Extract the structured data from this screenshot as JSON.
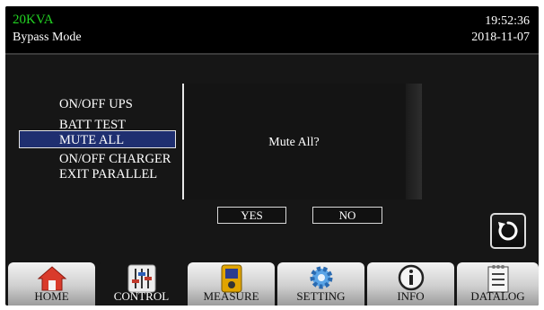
{
  "header": {
    "rating": "20KVA",
    "mode": "Bypass Mode",
    "time": "19:52:36",
    "date": "2018-11-07"
  },
  "menu": {
    "items": [
      "ON/OFF UPS",
      "BATT TEST",
      "MUTE ALL",
      "ON/OFF CHARGER",
      "EXIT PARALLEL"
    ],
    "selected": "MUTE ALL"
  },
  "dialog": {
    "message": "Mute All?",
    "yes_label": "YES",
    "no_label": "NO"
  },
  "back_button": {
    "icon": "refresh-back-icon"
  },
  "navbar": {
    "tabs": [
      {
        "label": "HOME",
        "icon": "home-icon"
      },
      {
        "label": "CONTROL",
        "icon": "sliders-icon"
      },
      {
        "label": "MEASURE",
        "icon": "meter-icon"
      },
      {
        "label": "SETTING",
        "icon": "gear-icon"
      },
      {
        "label": "INFO",
        "icon": "info-icon"
      },
      {
        "label": "DATALOG",
        "icon": "log-icon"
      }
    ],
    "active": "CONTROL"
  },
  "colors": {
    "rating_text": "#22d422",
    "selection_bg": "#1f2f70",
    "screen_bg": "#161616",
    "header_bg": "#000000"
  }
}
